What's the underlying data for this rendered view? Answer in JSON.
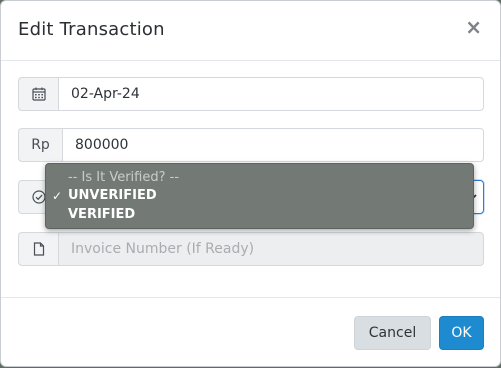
{
  "dialog": {
    "title": "Edit Transaction",
    "close_glyph": "×"
  },
  "fields": {
    "date": {
      "icon": "calendar-icon",
      "value": "02-Apr-24"
    },
    "amount": {
      "prefix": "Rp",
      "value": "800000"
    },
    "verification": {
      "icon": "check-circle-icon",
      "options": [
        {
          "label": "-- Is It Verified? --",
          "selected": false
        },
        {
          "label": "UNVERIFIED",
          "selected": true
        },
        {
          "label": "VERIFIED",
          "selected": false
        }
      ],
      "check_glyph": "✓"
    },
    "invoice": {
      "icon": "file-icon",
      "placeholder": "Invoice Number (If Ready)",
      "disabled": true
    }
  },
  "footer": {
    "cancel_label": "Cancel",
    "ok_label": "OK"
  },
  "colors": {
    "primary": "#1e8bd0",
    "dropdown_bg": "#737a76"
  }
}
